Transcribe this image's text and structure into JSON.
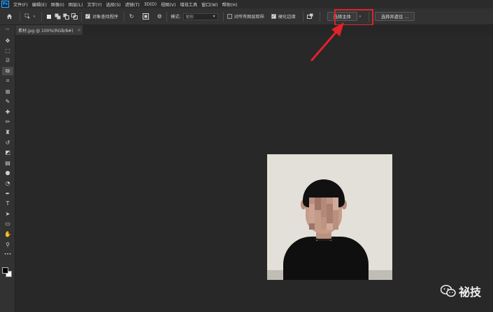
{
  "app": {
    "logo": "Ps"
  },
  "menu": [
    "文件(F)",
    "编辑(E)",
    "图像(I)",
    "图层(L)",
    "文字(Y)",
    "选择(S)",
    "滤镜(T)",
    "3D(D)",
    "视图(V)",
    "增效工具",
    "窗口(W)",
    "帮助(H)"
  ],
  "options": {
    "sample_all_label": "对象查找程序",
    "mode_label": "模式:",
    "mode_value": "矩形",
    "sample_all_layers_label": "对所有图层取样",
    "hard_edge_label": "硬化边缘",
    "select_subject_label": "选择主体",
    "select_mask_label": "选择并遮住 ..."
  },
  "document_tab": {
    "title": "素材.jpg @ 100%(RGB/8#)",
    "close": "×"
  },
  "tools": [
    "move-icon",
    "marquee-icon",
    "lasso-icon",
    "object-select-icon",
    "crop-icon",
    "frame-icon",
    "eyedropper-icon",
    "healing-icon",
    "brush-icon",
    "clone-stamp-icon",
    "history-brush-icon",
    "eraser-icon",
    "gradient-icon",
    "blur-icon",
    "dodge-icon",
    "pen-icon",
    "type-icon",
    "path-select-icon",
    "rectangle-icon",
    "hand-icon",
    "zoom-icon",
    "more-icon"
  ],
  "colors": {
    "foreground": "#000000",
    "background": "#ffffff",
    "highlight": "#e0222b"
  },
  "watermark": {
    "text": "祕技"
  }
}
